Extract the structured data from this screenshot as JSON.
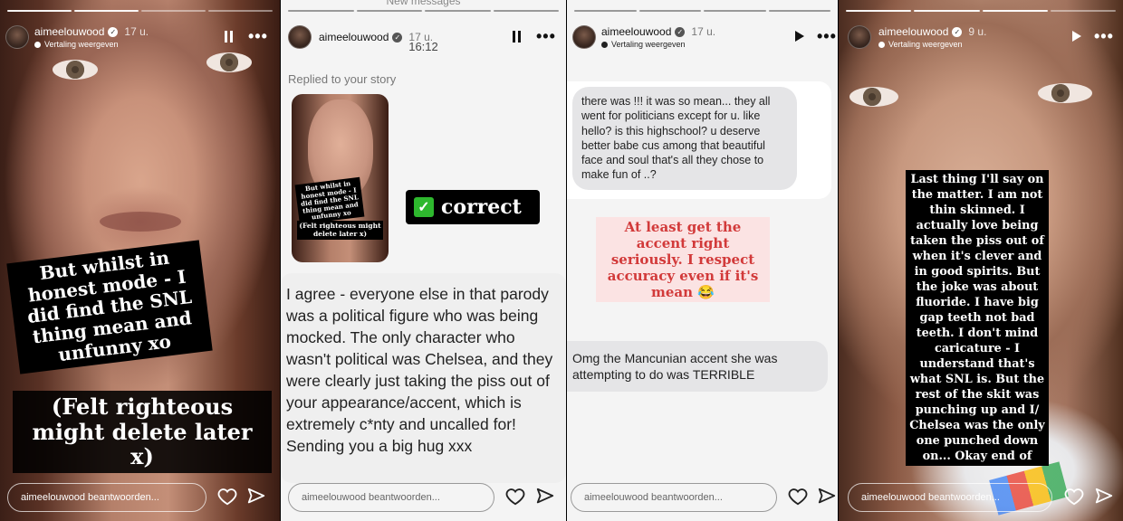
{
  "stories": [
    {
      "username": "aimeelouwood",
      "age": "17 u.",
      "subtitle": "Vertaling weergeven",
      "caption_main": "But whilst in honest mode - I did find the SNL thing mean and unfunny xo",
      "caption_secondary": "(Felt righteous might delete later x)",
      "reply_placeholder": "aimeelouwood beantwoorden...",
      "playback_icon": "pause-icon"
    },
    {
      "username": "aimeelouwood",
      "age": "17 u.",
      "banner": "New messages",
      "time": "16:12",
      "replied_label": "Replied to your story",
      "thumb_caption_main": "But whilst in honest mode - I did find the SNL thing mean and unfunny xo",
      "thumb_caption_secondary": "(Felt righteous might delete later x)",
      "sticker_text": "correct",
      "message": "I agree - everyone else in that parody was a political figure who was being mocked. The only character who wasn't political was Chelsea, and they were clearly just taking the piss out of your appearance/accent, which is extremely c*nty and uncalled for! Sending you a big hug xxx",
      "reply_placeholder": "aimeelouwood beantwoorden...",
      "playback_icon": "pause-icon"
    },
    {
      "username": "aimeelouwood",
      "age": "17 u.",
      "subtitle": "Vertaling weergeven",
      "message_top": "there was !!! it was so mean... they all went for politicians except for u. like hello? is this highschool? u deserve better babe cus among that beautiful face and soul that's all they chose to make fun of ..?",
      "caption": "At least get the accent right seriously. I respect accuracy even if it's mean 😂",
      "message_bottom": "Omg the Mancunian accent she was attempting to do was TERRIBLE",
      "reply_placeholder": "aimeelouwood beantwoorden...",
      "playback_icon": "play-icon"
    },
    {
      "username": "aimeelouwood",
      "age": "9 u.",
      "subtitle": "Vertaling weergeven",
      "caption": "Last thing I'll say on the matter. I am not thin skinned. I actually love being taken the piss out of when it's clever and in good spirits. But the joke was about fluoride. I have big gap teeth not bad teeth. I don't mind caricature - I understand that's what SNL is. But the rest of the skit was punching up and I/ Chelsea was the only one punched down on... Okay end of",
      "reply_placeholder": "aimeelouwood beantwoorden...",
      "playback_icon": "play-icon"
    }
  ],
  "colors": {
    "sticker_bg": "#000000",
    "pink_bg": "#fbe3e3",
    "pink_text": "#d23a3a",
    "bubble_bg": "#e5e5e7",
    "check_green": "#2eb82e"
  }
}
